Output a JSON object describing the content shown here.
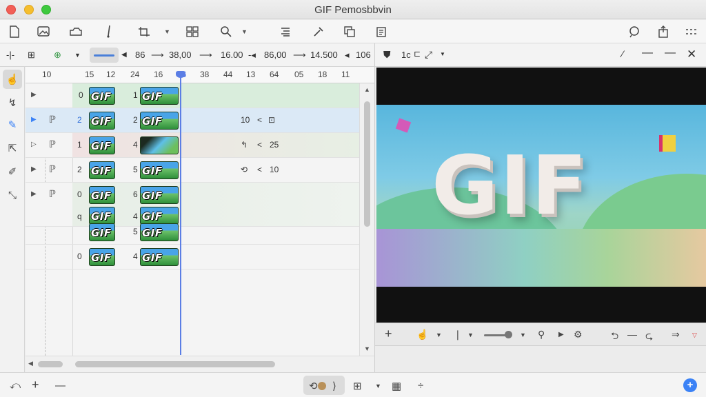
{
  "window": {
    "title": "GIF Pemosbbvin"
  },
  "colors": {
    "accent": "#5b7ee5",
    "selection": "#dbe9f6",
    "close": "#f25f57",
    "minimize": "#f5be2e",
    "zoom": "#3ec93e"
  },
  "toolbar1": {
    "icons": [
      "new-document-icon",
      "image-icon",
      "layers-icon",
      "brush-icon",
      "crop-icon",
      "grid-icon",
      "zoom-icon",
      "align-icon",
      "eyedropper-icon",
      "duplicate-icon",
      "clipboard-icon",
      "search-icon",
      "share-icon",
      "more-icon"
    ]
  },
  "toolbar2": {
    "values": [
      "86",
      "38,00",
      "16.00",
      "86,00",
      "14.500",
      "106"
    ],
    "preview_zoom": "1c"
  },
  "ruler": {
    "ticks": [
      "10",
      "15",
      "12",
      "24",
      "16",
      "06",
      "38",
      "44",
      "13",
      "64",
      "05",
      "18",
      "11"
    ]
  },
  "rows": [
    {
      "num1": "0",
      "thumb1": "GIF",
      "num2": "1",
      "thumb2": "GIF",
      "info": ""
    },
    {
      "num1": "2",
      "thumb1": "GIF",
      "num2": "2",
      "thumb2": "GIF",
      "info_val": "10",
      "info_sym": "<"
    },
    {
      "num1": "1",
      "thumb1": "GIF",
      "num2": "4",
      "thumb2": "",
      "info_val": "25",
      "info_sym": "<"
    },
    {
      "num1": "2",
      "thumb1": "GIF",
      "num2": "5",
      "thumb2": "GIF",
      "info_val": "10",
      "info_sym": "<"
    },
    {
      "num1": "0",
      "thumb1": "GIF",
      "num2": "6",
      "thumb2": "GIF"
    },
    {
      "num1": "q",
      "thumb1": "GIF",
      "num2": "4",
      "thumb2": "GIF"
    },
    {
      "num1": "",
      "thumb1": "GIF",
      "num2": "5",
      "thumb2": "GIF"
    },
    {
      "num1": "0",
      "thumb1": "GIF",
      "num2": "4",
      "thumb2": "GIF"
    }
  ],
  "preview": {
    "text": "GIF"
  }
}
